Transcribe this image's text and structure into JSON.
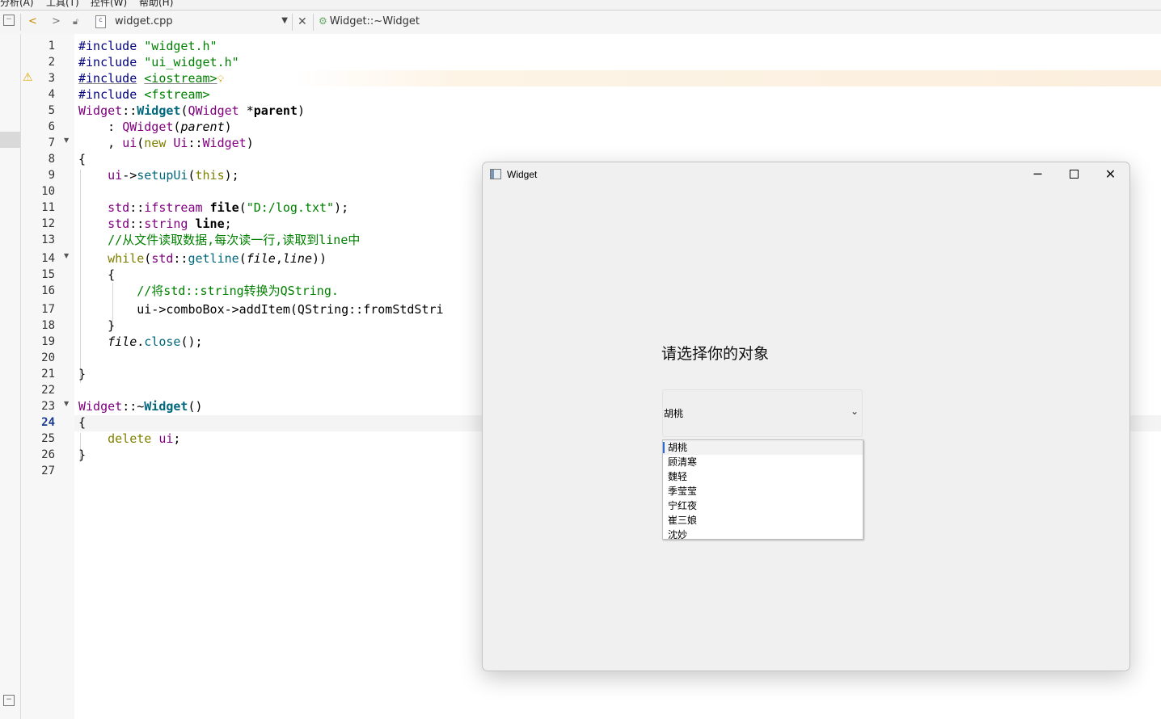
{
  "menu": [
    "分析(A)",
    "工具(T)",
    "控件(W)",
    "帮助(H)"
  ],
  "toolbar": {
    "file_name": "widget.cpp",
    "function_name": "Widget::~Widget"
  },
  "gutter": {
    "line_numbers": [
      "1",
      "2",
      "3",
      "4",
      "5",
      "6",
      "7",
      "8",
      "9",
      "10",
      "11",
      "12",
      "13",
      "14",
      "15",
      "16",
      "17",
      "18",
      "19",
      "20",
      "21",
      "22",
      "23",
      "24",
      "25",
      "26",
      "27"
    ],
    "current_line": "24",
    "warning_line": "3"
  },
  "code": {
    "l1_kw": "#include",
    "l1_str": "\"widget.h\"",
    "l2_kw": "#include",
    "l2_str": "\"ui_widget.h\"",
    "l3_kw": "#include",
    "l3_str": "<iostream>",
    "l4_kw": "#include",
    "l4_str": "<fstream>",
    "l13_comment": "//从文件读取数据,每次读一行,读取到line中",
    "l16_comment": "//将std::string转换为QString.",
    "l17_text": "ui->comboBox->addItem(QString::fromStdStri"
  },
  "qt_window": {
    "title": "Widget",
    "minimize_glyph": "─",
    "close_glyph": "✕",
    "label": "请选择你的对象",
    "combo_value": "胡桃",
    "combo_options": [
      "胡桃",
      "顾清寒",
      "魏轻",
      "季莹莹",
      "宁红夜",
      "崔三娘",
      "沈妙"
    ],
    "selected_index": 0
  }
}
